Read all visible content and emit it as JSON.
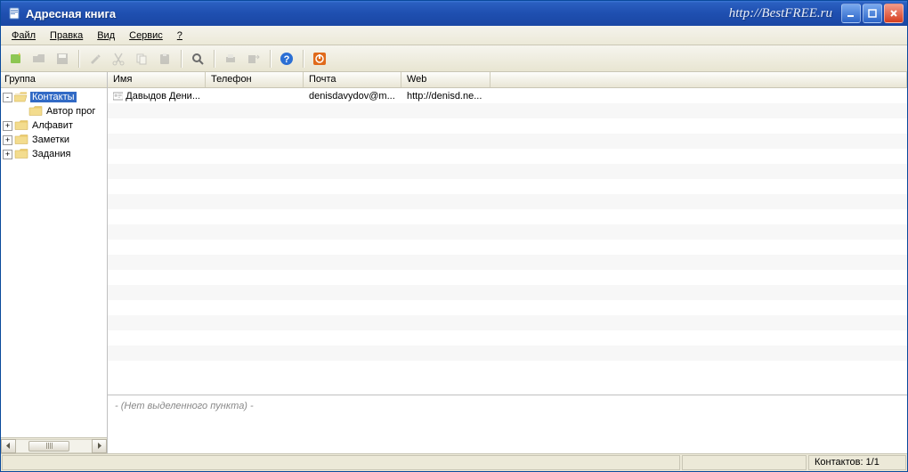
{
  "title": "Адресная книга",
  "watermark_url": "http://BestFREE.ru",
  "menu": {
    "file": "Файл",
    "edit": "Правка",
    "view": "Вид",
    "service": "Сервис",
    "help": "?"
  },
  "toolbar": {
    "items": [
      {
        "name": "new-contact",
        "color": "#7bbf3a",
        "disabled": false
      },
      {
        "name": "open-folder",
        "color": "#9a9a9a",
        "disabled": true
      },
      {
        "name": "save",
        "color": "#9a9a9a",
        "disabled": true
      },
      {
        "sep": true
      },
      {
        "name": "edit",
        "color": "#9a9a9a",
        "disabled": true
      },
      {
        "name": "cut",
        "color": "#9a9a9a",
        "disabled": true
      },
      {
        "name": "copy",
        "color": "#9a9a9a",
        "disabled": true
      },
      {
        "name": "paste",
        "color": "#9a9a9a",
        "disabled": true
      },
      {
        "sep": true
      },
      {
        "name": "search",
        "color": "#6b6b6b",
        "disabled": false
      },
      {
        "sep": true
      },
      {
        "name": "print",
        "color": "#9a9a9a",
        "disabled": true
      },
      {
        "name": "export",
        "color": "#9a9a9a",
        "disabled": true
      },
      {
        "sep": true
      },
      {
        "name": "help",
        "color": "#2b6fd4",
        "disabled": false
      },
      {
        "sep": true
      },
      {
        "name": "power",
        "color": "#e06a1b",
        "disabled": false
      }
    ]
  },
  "sidebar": {
    "header": "Группа",
    "tree": [
      {
        "level": 0,
        "exp": "-",
        "icon": "folder-open",
        "label": "Контакты",
        "selected": true
      },
      {
        "level": 1,
        "exp": "",
        "icon": "folder",
        "label": "Автор прог",
        "selected": false
      },
      {
        "level": 0,
        "exp": "+",
        "icon": "folder",
        "label": "Алфавит",
        "selected": false
      },
      {
        "level": 0,
        "exp": "+",
        "icon": "folder",
        "label": "Заметки",
        "selected": false
      },
      {
        "level": 0,
        "exp": "+",
        "icon": "folder",
        "label": "Задания",
        "selected": false
      }
    ]
  },
  "grid": {
    "columns": [
      "Имя",
      "Телефон",
      "Почта",
      "Web",
      ""
    ],
    "rows": [
      {
        "name": "Давыдов Дени...",
        "phone": "",
        "mail": "denisdavydov@m...",
        "web": "http://denisd.ne..."
      }
    ],
    "blank_rows": 18
  },
  "detail_empty": "- (Нет выделенного пункта) -",
  "status": {
    "left": "",
    "mid": "",
    "right": "Контактов: 1/1"
  }
}
